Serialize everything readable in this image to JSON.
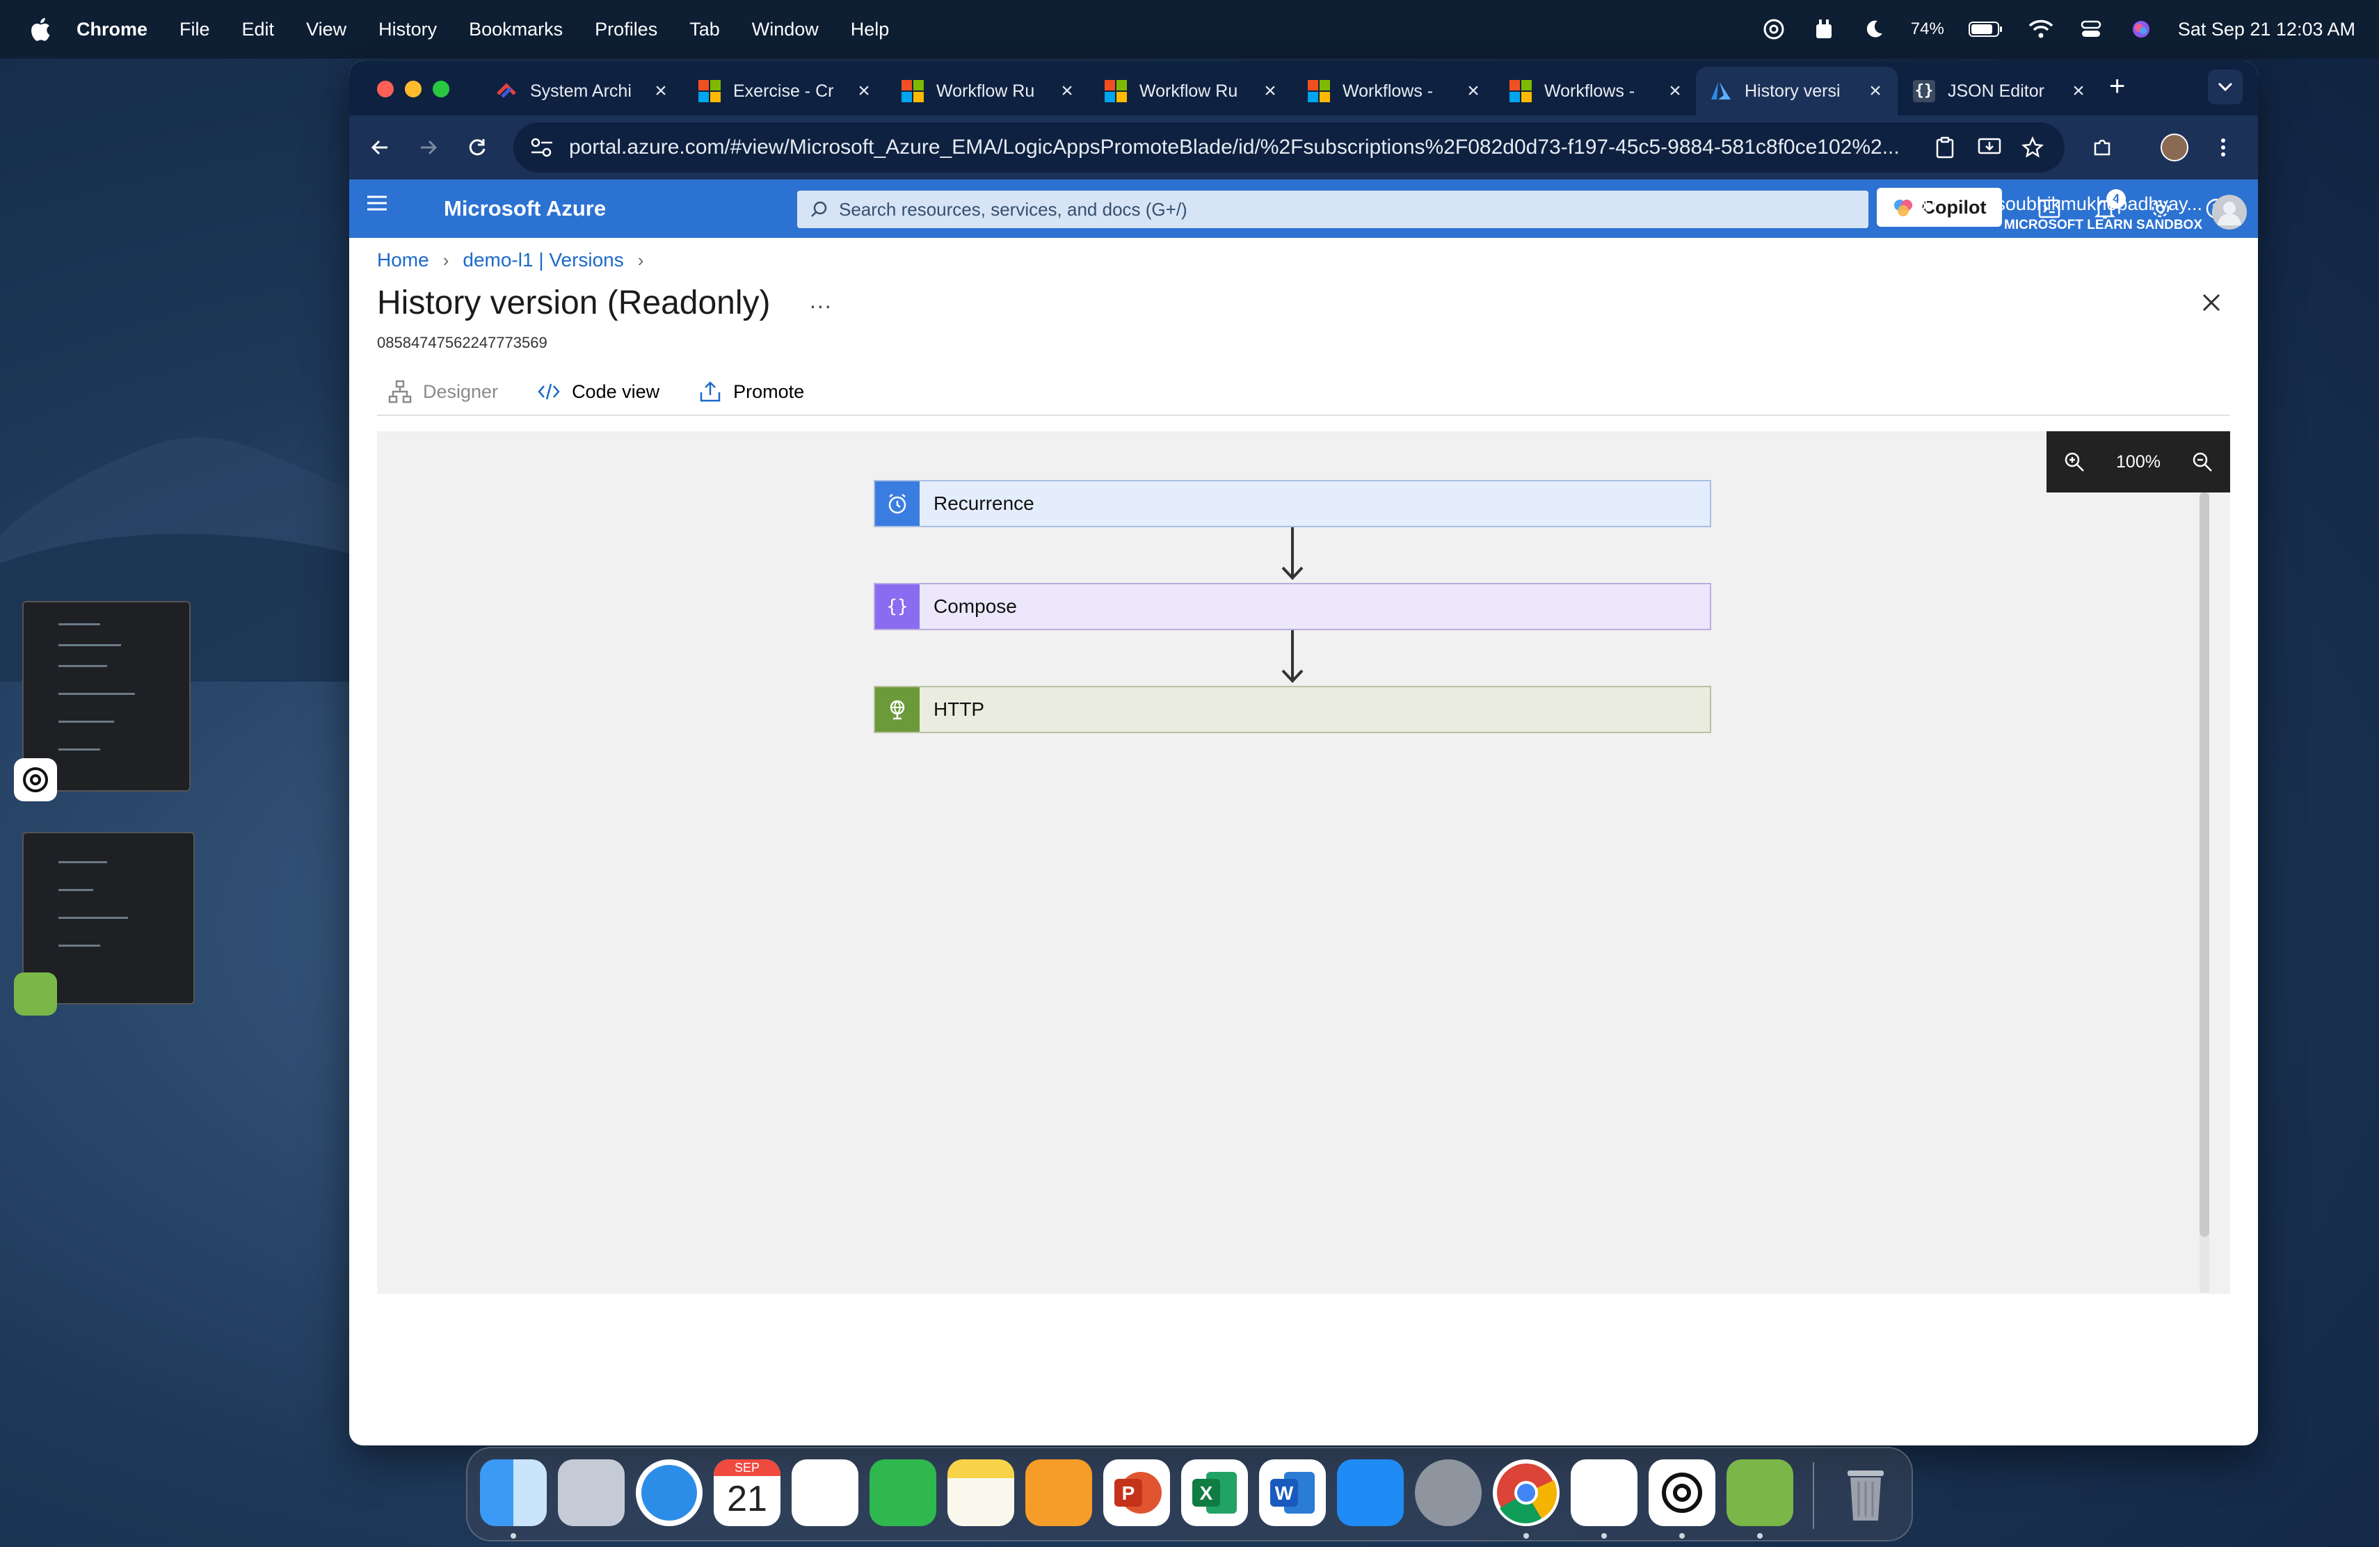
{
  "menubar": {
    "app_name": "Chrome",
    "items": [
      "File",
      "Edit",
      "View",
      "History",
      "Bookmarks",
      "Profiles",
      "Tab",
      "Window",
      "Help"
    ],
    "battery": "74%",
    "datetime": "Sat Sep 21  12:03 AM"
  },
  "browser": {
    "tabs": [
      {
        "title": "System Archi",
        "icon": "aws-icon"
      },
      {
        "title": "Exercise - Cr",
        "icon": "microsoft-logo-icon"
      },
      {
        "title": "Workflow Ru",
        "icon": "microsoft-logo-icon"
      },
      {
        "title": "Workflow Ru",
        "icon": "microsoft-logo-icon"
      },
      {
        "title": "Workflows - ",
        "icon": "microsoft-logo-icon"
      },
      {
        "title": "Workflows - ",
        "icon": "microsoft-logo-icon"
      },
      {
        "title": "History versi",
        "icon": "azure-icon",
        "active": true
      },
      {
        "title": "JSON Editor",
        "icon": "json-icon"
      }
    ],
    "url": "portal.azure.com/#view/Microsoft_Azure_EMA/LogicAppsPromoteBlade/id/%2Fsubscriptions%2F082d0d73-f197-45c5-9884-581c8f0ce102%2..."
  },
  "azure": {
    "brand": "Microsoft Azure",
    "search_placeholder": "Search resources, services, and docs (G+/)",
    "copilot_label": "Copilot",
    "notification_count": "4",
    "user_name": "soubhikmukhopadhyay...",
    "user_directory": "MICROSOFT LEARN SANDBOX"
  },
  "page": {
    "breadcrumb": [
      "Home",
      "demo-l1 | Versions"
    ],
    "title": "History version (Readonly)",
    "more": "...",
    "version_id": "08584747562247773569",
    "commands": {
      "designer": "Designer",
      "code_view": "Code view",
      "promote": "Promote"
    },
    "zoom_level": "100%"
  },
  "workflow": {
    "nodes": [
      {
        "label": "Recurrence",
        "icon": "clock-icon",
        "accent": "#3a7de0",
        "fill": "#e4edfb"
      },
      {
        "label": "Compose",
        "icon": "braces-icon",
        "accent": "#8a6cf0",
        "fill": "#ece7fb"
      },
      {
        "label": "HTTP",
        "icon": "globe-icon",
        "accent": "#6b9a3a",
        "fill": "#e9ecdf"
      }
    ]
  },
  "dock": {
    "calendar_month": "SEP",
    "calendar_day": "21"
  },
  "colors": {
    "azure_blue": "#2c72d2",
    "link_blue": "#1b6ac9",
    "chrome_dark": "#0f2140"
  }
}
